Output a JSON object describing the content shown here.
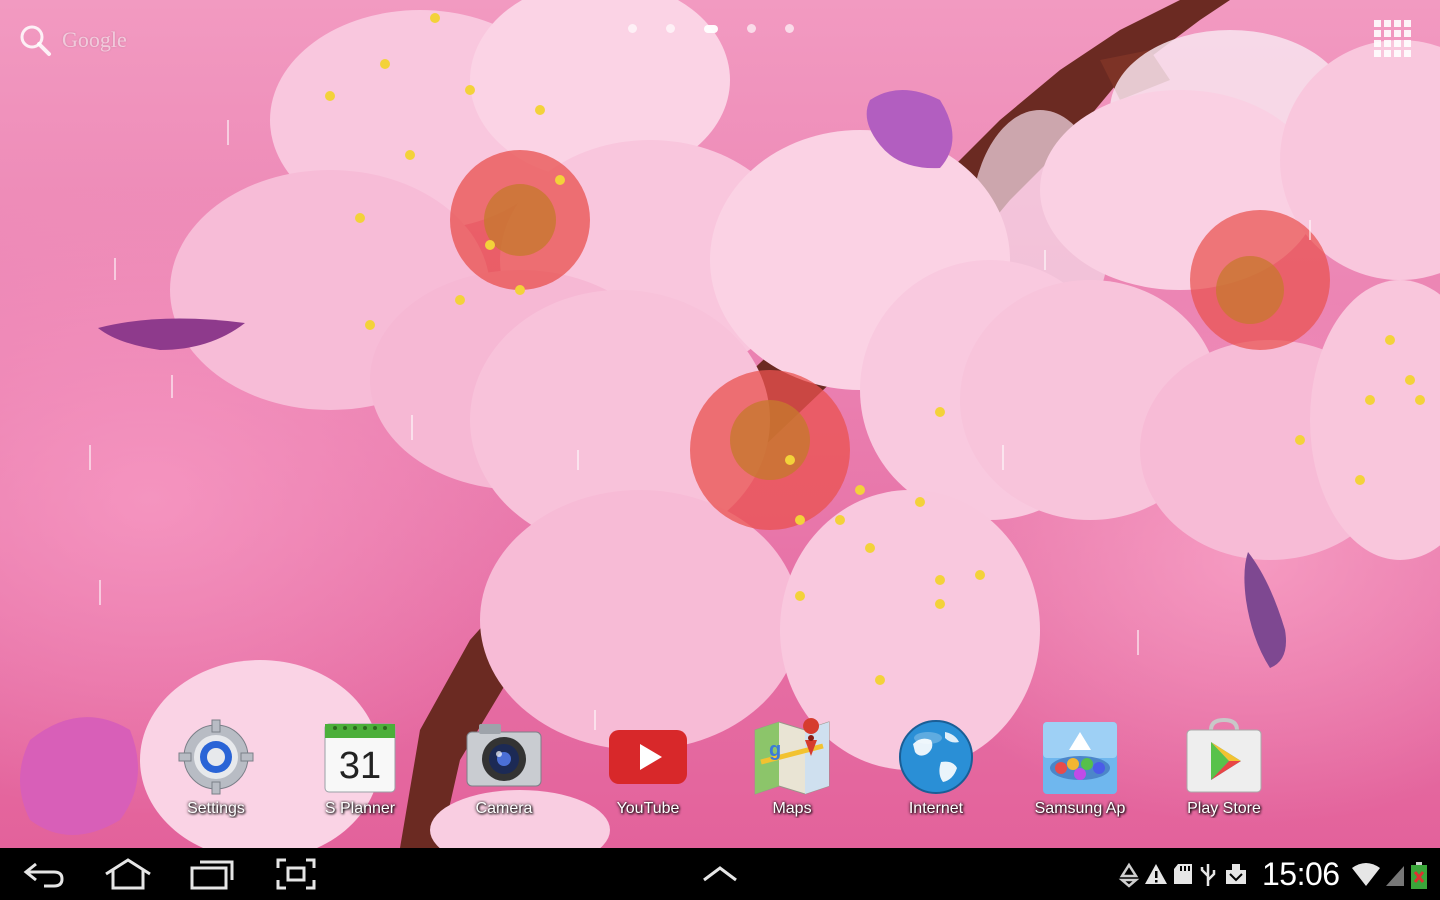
{
  "top_bar": {
    "search_label": "Google",
    "search_icon": "search-icon",
    "page_count": 5,
    "active_page": 3,
    "apps_button_icon": "apps-grid-icon"
  },
  "dock": {
    "apps": [
      {
        "label": "Settings",
        "icon": "settings-icon"
      },
      {
        "label": "S Planner",
        "icon": "calendar-icon",
        "calendar_day": "31"
      },
      {
        "label": "Camera",
        "icon": "camera-icon"
      },
      {
        "label": "YouTube",
        "icon": "youtube-icon"
      },
      {
        "label": "Maps",
        "icon": "maps-icon"
      },
      {
        "label": "Internet",
        "icon": "globe-icon"
      },
      {
        "label": "Samsung Ap",
        "icon": "samsung-apps-icon"
      },
      {
        "label": "Play Store",
        "icon": "play-store-icon"
      }
    ]
  },
  "navbar": {
    "back_icon": "back-icon",
    "home_icon": "home-icon",
    "recents_icon": "recent-apps-icon",
    "screenshot_icon": "screenshot-icon",
    "up_icon": "chevron-up-icon",
    "clock": "15:06",
    "status_icons": [
      "recycle-icon",
      "warning-icon",
      "sd-card-icon",
      "usb-icon",
      "download-icon",
      "wifi-icon",
      "battery-icon"
    ]
  },
  "colors": {
    "youtube_red": "#d8282a",
    "globe_blue": "#2a8fd6",
    "battery_red": "#e03030",
    "navbar_bg": "#000000"
  }
}
